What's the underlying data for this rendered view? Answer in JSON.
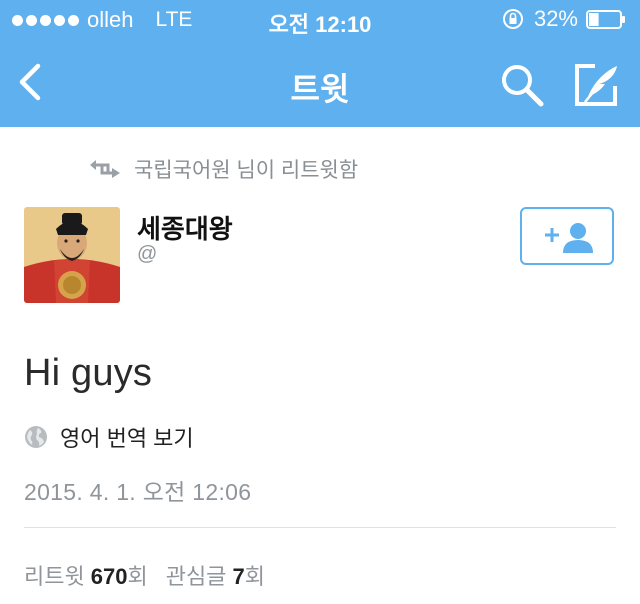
{
  "status_bar": {
    "carrier": "olleh",
    "network": "LTE",
    "time": "오전 12:10",
    "battery_percent": "32%",
    "battery_level": 0.32
  },
  "nav": {
    "title": "트윗",
    "icons": [
      "back-icon",
      "search-icon",
      "compose-icon"
    ]
  },
  "retweet": {
    "text": "국립국어원 님이 리트윗함"
  },
  "user": {
    "name": "세종대왕",
    "handle": "@"
  },
  "tweet": {
    "text": "Hi guys",
    "translate_label": "영어 번역 보기",
    "timestamp": "2015. 4. 1. 오전 12:06"
  },
  "stats": {
    "retweet_label": "리트윗",
    "retweet_count": "670",
    "retweet_unit": "회",
    "like_label": "관심글",
    "like_count": "7",
    "like_unit": "회"
  },
  "colors": {
    "accent": "#5eb0ee",
    "muted_text": "#8f959a"
  }
}
